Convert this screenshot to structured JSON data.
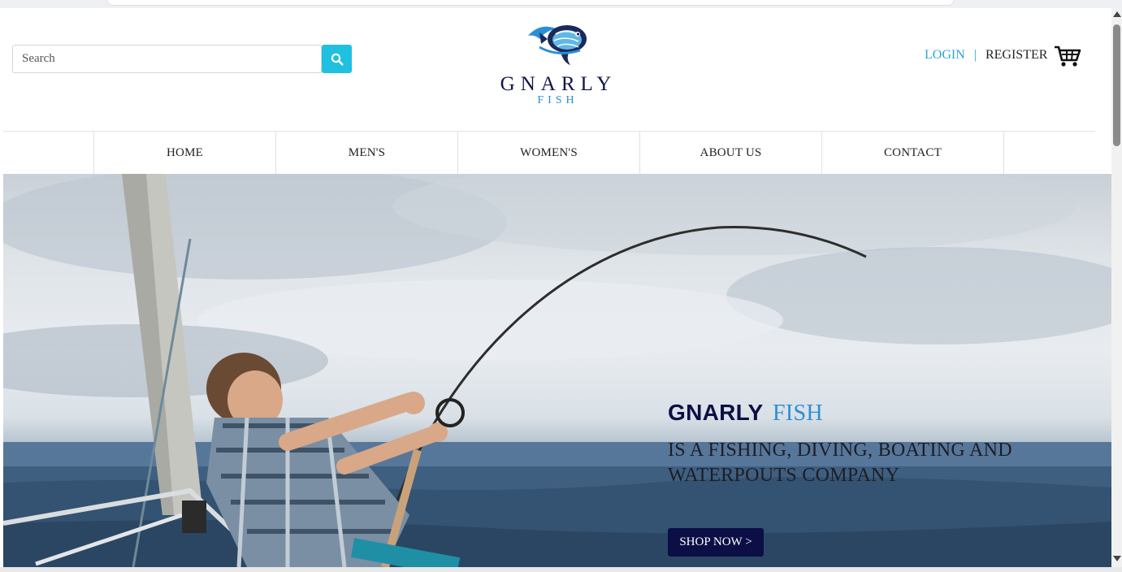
{
  "header": {
    "search": {
      "placeholder": "Search",
      "value": ""
    },
    "logo": {
      "name": "GNARLY",
      "sub": "FISH"
    },
    "account": {
      "login": "LOGIN",
      "separator": "|",
      "register": "REGISTER"
    }
  },
  "nav": {
    "items": [
      {
        "label": "HOME"
      },
      {
        "label": "MEN'S"
      },
      {
        "label": "WOMEN'S"
      },
      {
        "label": "ABOUT US"
      },
      {
        "label": "CONTACT"
      }
    ]
  },
  "hero": {
    "title_main": "GNARLY",
    "title_accent": "FISH",
    "subtitle": "IS A FISHING, DIVING, BOATING AND WATERPOUTS COMPANY",
    "cta": "SHOP NOW >"
  },
  "icons": {
    "search": "search-icon",
    "cart": "cart-icon",
    "logo": "fish-logo-icon"
  },
  "colors": {
    "accent": "#1fc0e0",
    "brand_navy": "#0b0f45",
    "link_blue": "#29a6d6",
    "logo_blue": "#2a8fd6"
  }
}
